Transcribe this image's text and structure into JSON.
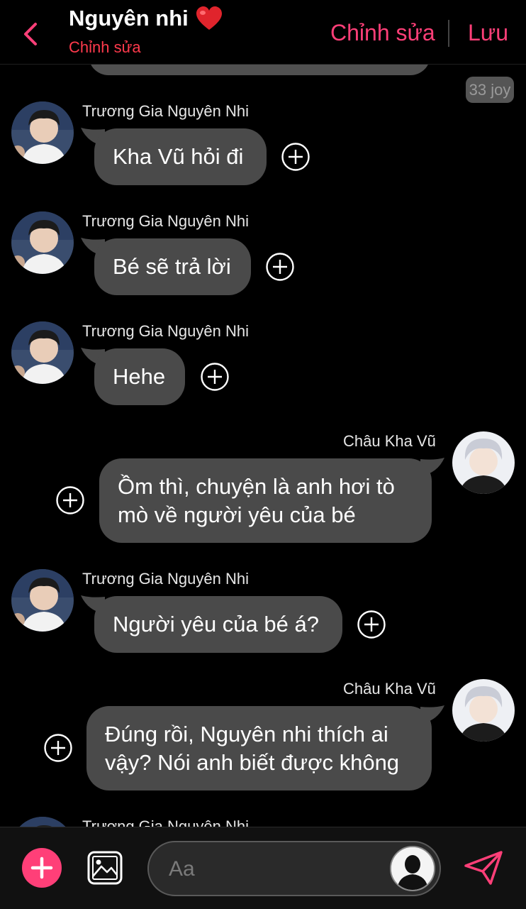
{
  "header": {
    "title": "Nguyên nhi",
    "subtitle": "Chỉnh sửa",
    "edit_label": "Chỉnh sửa",
    "save_label": "Lưu",
    "accent_color": "#ff3f78"
  },
  "time_badge": "33 joy",
  "messages": [
    {
      "side": "left",
      "sender": "Trương Gia Nguyên Nhi",
      "text": "Kha Vũ hỏi đi"
    },
    {
      "side": "left",
      "sender": "Trương Gia Nguyên Nhi",
      "text": "Bé sẽ trả lời"
    },
    {
      "side": "left",
      "sender": "Trương Gia Nguyên Nhi",
      "text": "Hehe"
    },
    {
      "side": "right",
      "sender": "Châu Kha Vũ",
      "text_line1": "Ồm thì, chuyện là anh hơi tò",
      "text_line2": "mò về người yêu của bé"
    },
    {
      "side": "left",
      "sender": "Trương Gia Nguyên Nhi",
      "text": "Người yêu của bé á?"
    },
    {
      "side": "right",
      "sender": "Châu Kha Vũ",
      "text_line1": "Đúng rồi, Nguyên nhi thích ai",
      "text_line2": "vậy? Nói anh biết được không"
    },
    {
      "side": "left",
      "sender": "Trương Gia Nguyên Nhi"
    }
  ],
  "composer": {
    "placeholder": "Aa"
  },
  "icons": [
    "back-chevron-icon",
    "heart-icon",
    "add-reaction-icon",
    "plus-icon",
    "image-icon",
    "user-silhouette-icon",
    "send-icon"
  ]
}
